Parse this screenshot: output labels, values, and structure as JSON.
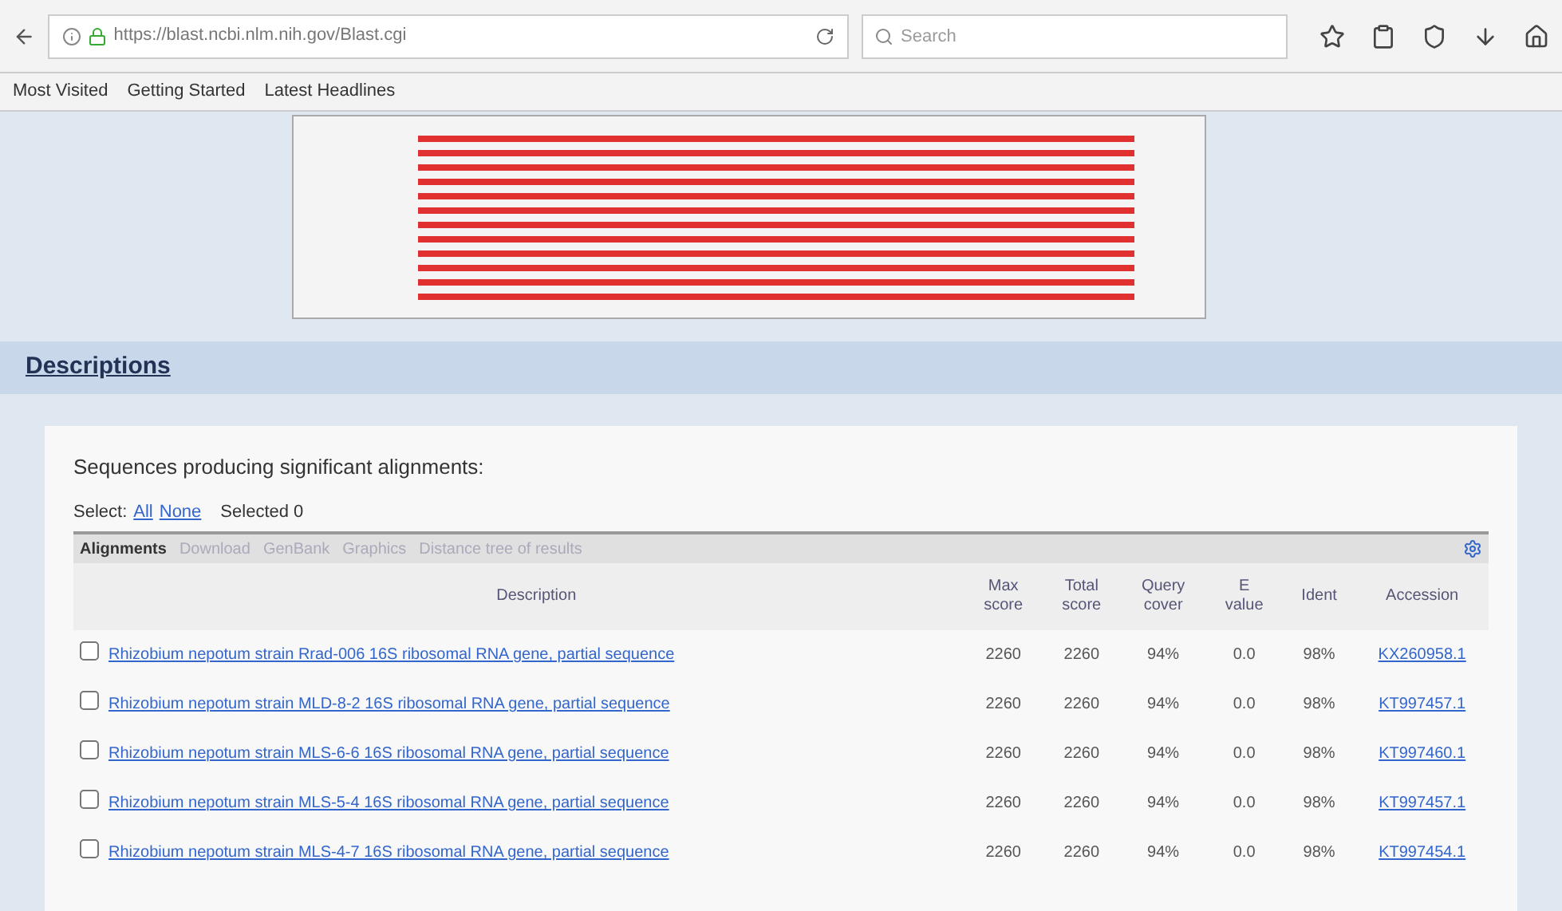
{
  "browser": {
    "url": "https://blast.ncbi.nlm.nih.gov/Blast.cgi",
    "search": {
      "placeholder": "Search"
    },
    "bookmarks": [
      "Most Visited",
      "Getting Started",
      "Latest Headlines"
    ]
  },
  "section": {
    "title": "Descriptions"
  },
  "results": {
    "heading": "Sequences producing significant alignments:",
    "select_label": "Select:",
    "select_links": [
      "All",
      "None"
    ],
    "selected_text": "Selected 0",
    "toolbar": {
      "title": "Alignments",
      "links": [
        "Download",
        "GenBank",
        "Graphics",
        "Distance tree of results"
      ]
    },
    "columns": [
      {
        "lines": [
          "Description"
        ]
      },
      {
        "lines": [
          "Max",
          "score"
        ]
      },
      {
        "lines": [
          "Total",
          "score"
        ]
      },
      {
        "lines": [
          "Query",
          "cover"
        ]
      },
      {
        "lines": [
          "E",
          "value"
        ]
      },
      {
        "lines": [
          "Ident"
        ]
      },
      {
        "lines": [
          "Accession"
        ]
      }
    ],
    "rows": [
      {
        "checked": false,
        "description": "Rhizobium nepotum strain Rrad-006 16S ribosomal RNA gene, partial sequence",
        "max_score": "2260",
        "total_score": "2260",
        "query_cover": "94%",
        "e_value": "0.0",
        "ident": "98%",
        "accession": "KX260958.1"
      },
      {
        "checked": false,
        "description": "Rhizobium nepotum strain MLD-8-2 16S ribosomal RNA gene, partial sequence",
        "max_score": "2260",
        "total_score": "2260",
        "query_cover": "94%",
        "e_value": "0.0",
        "ident": "98%",
        "accession": "KT997457.1"
      },
      {
        "checked": false,
        "description": "Rhizobium nepotum strain MLS-6-6 16S ribosomal RNA gene, partial sequence",
        "max_score": "2260",
        "total_score": "2260",
        "query_cover": "94%",
        "e_value": "0.0",
        "ident": "98%",
        "accession": "KT997460.1"
      },
      {
        "checked": false,
        "description": "Rhizobium nepotum strain MLS-5-4 16S ribosomal RNA gene, partial sequence",
        "max_score": "2260",
        "total_score": "2260",
        "query_cover": "94%",
        "e_value": "0.0",
        "ident": "98%",
        "accession": "KT997457.1"
      },
      {
        "checked": false,
        "description": "Rhizobium nepotum strain MLS-4-7 16S ribosomal RNA gene, partial sequence",
        "max_score": "2260",
        "total_score": "2260",
        "query_cover": "94%",
        "e_value": "0.0",
        "ident": "98%",
        "accession": "KT997454.1"
      }
    ]
  }
}
